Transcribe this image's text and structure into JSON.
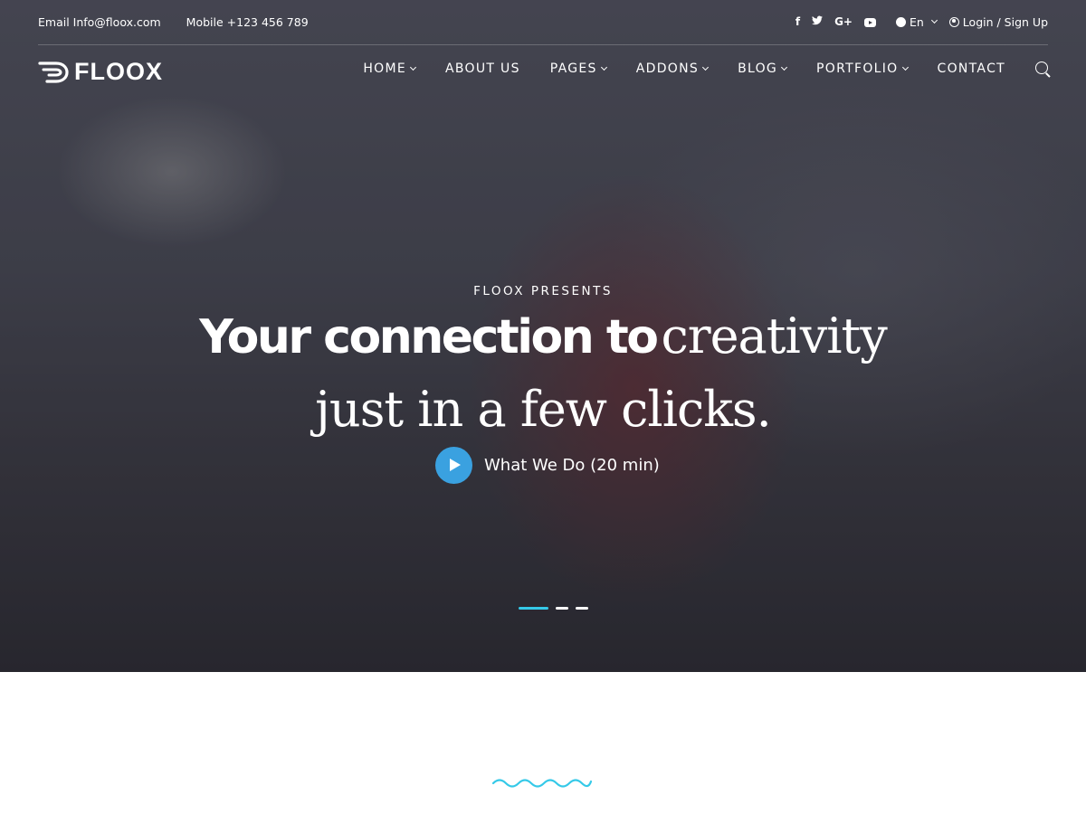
{
  "topbar": {
    "email": "Email Info@floox.com",
    "mobile": "Mobile +123 456 789",
    "social": [
      {
        "name": "facebook-icon",
        "glyph": "f"
      },
      {
        "name": "twitter-icon",
        "glyph": "ᵛ"
      },
      {
        "name": "google-plus-icon",
        "glyph": "G+"
      },
      {
        "name": "youtube-icon",
        "glyph": ""
      }
    ],
    "language": "En",
    "login": "Login / Sign Up"
  },
  "brand": {
    "name": "FLOOX"
  },
  "nav": {
    "items": [
      {
        "label": "HOME",
        "dropdown": true
      },
      {
        "label": "ABOUT US",
        "dropdown": false
      },
      {
        "label": "PAGES",
        "dropdown": true
      },
      {
        "label": "ADDONS",
        "dropdown": true
      },
      {
        "label": "BLOG",
        "dropdown": true
      },
      {
        "label": "PORTFOLIO",
        "dropdown": true
      },
      {
        "label": "CONTACT",
        "dropdown": false
      }
    ]
  },
  "hero": {
    "eyebrow": "FLOOX PRESENTS",
    "headline_bold": "Your connection to",
    "headline_serif_1": "creativity",
    "headline_serif_2": "just in a few clicks.",
    "video_label": "What We Do (20 min)",
    "slides": {
      "count": 3,
      "active": 1
    }
  },
  "colors": {
    "accent": "#35c9e8",
    "play_button": "#3aa1e0"
  }
}
